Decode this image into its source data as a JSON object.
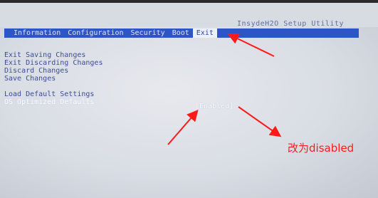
{
  "bios": {
    "title": "InsydeH2O Setup Utility",
    "menu": [
      {
        "label": "Information"
      },
      {
        "label": "Configuration"
      },
      {
        "label": "Security"
      },
      {
        "label": "Boot"
      },
      {
        "label": "Exit",
        "active": true
      }
    ],
    "options": [
      "Exit Saving Changes",
      "Exit Discarding Changes",
      "Discard Changes",
      "Save Changes",
      "Load Default Settings",
      "OS Optimized Defaults"
    ],
    "os_optimized_value": "[Enabled]"
  },
  "annotation": {
    "text": "改为disabled",
    "color": "#ff1a1a"
  }
}
